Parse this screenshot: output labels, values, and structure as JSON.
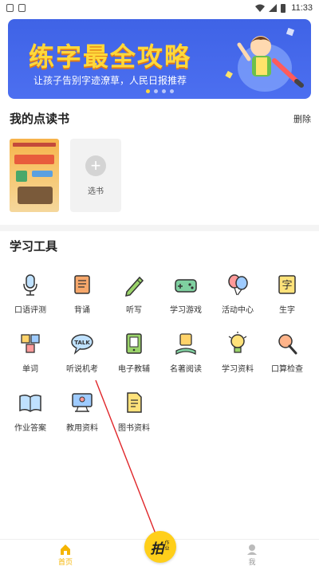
{
  "status_bar": {
    "time": "11:33"
  },
  "banner": {
    "title": "练字最全攻略",
    "subtitle": "让孩子告别字迹潦草，人民日报推荐",
    "dot_count": 4,
    "active_dot": 0
  },
  "my_books": {
    "title": "我的点读书",
    "delete_label": "删除",
    "add_label": "选书"
  },
  "tools": {
    "title": "学习工具",
    "items": [
      {
        "label": "口语评测",
        "icon": "microphone-icon"
      },
      {
        "label": "背诵",
        "icon": "book-icon"
      },
      {
        "label": "听写",
        "icon": "pencil-icon"
      },
      {
        "label": "学习游戏",
        "icon": "gamepad-icon"
      },
      {
        "label": "活动中心",
        "icon": "balloon-icon"
      },
      {
        "label": "生字",
        "icon": "character-card-icon"
      },
      {
        "label": "单词",
        "icon": "abc-blocks-icon"
      },
      {
        "label": "听说机考",
        "icon": "talk-bubble-icon"
      },
      {
        "label": "电子教辅",
        "icon": "ebook-icon"
      },
      {
        "label": "名著阅读",
        "icon": "reading-icon"
      },
      {
        "label": "学习资料",
        "icon": "lightbulb-icon"
      },
      {
        "label": "口算检查",
        "icon": "magnifier-icon"
      },
      {
        "label": "作业答案",
        "icon": "open-book-icon"
      },
      {
        "label": "教用资料",
        "icon": "teacher-board-icon"
      },
      {
        "label": "图书资料",
        "icon": "document-icon"
      }
    ]
  },
  "bottom_nav": {
    "home_label": "首页",
    "scan_main": "拍",
    "scan_sub": "作业",
    "me_label": "我"
  },
  "colors": {
    "accent": "#ffcf1a",
    "banner_bg": "#4c6ff0",
    "banner_title": "#ffd83a",
    "annotation_arrow": "#e0262a"
  }
}
